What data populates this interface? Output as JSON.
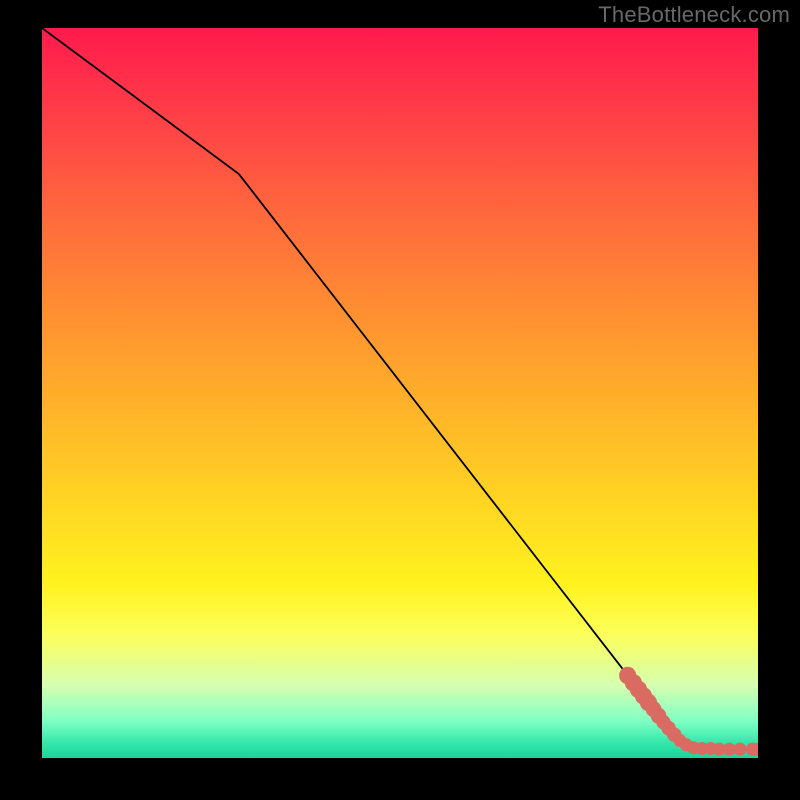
{
  "watermark": "TheBottleneck.com",
  "chart_data": {
    "type": "line",
    "title": "",
    "xlabel": "",
    "ylabel": "",
    "xlim": [
      0,
      100
    ],
    "ylim": [
      0,
      100
    ],
    "grid": false,
    "line_points": [
      {
        "x": 0,
        "y": 100
      },
      {
        "x": 27.5,
        "y": 80
      },
      {
        "x": 86,
        "y": 6
      },
      {
        "x": 91,
        "y": 1.4
      },
      {
        "x": 100,
        "y": 1.2
      }
    ],
    "markers": [
      {
        "x": 81.8,
        "y": 11.3,
        "r": 1.2
      },
      {
        "x": 82.6,
        "y": 10.3,
        "r": 1.2
      },
      {
        "x": 83.3,
        "y": 9.4,
        "r": 1.2
      },
      {
        "x": 84.0,
        "y": 8.5,
        "r": 1.2
      },
      {
        "x": 84.7,
        "y": 7.6,
        "r": 1.2
      },
      {
        "x": 85.4,
        "y": 6.7,
        "r": 1.1
      },
      {
        "x": 86.1,
        "y": 5.8,
        "r": 1.1
      },
      {
        "x": 86.8,
        "y": 4.9,
        "r": 1.0
      },
      {
        "x": 87.5,
        "y": 4.1,
        "r": 1.0
      },
      {
        "x": 88.3,
        "y": 3.2,
        "r": 1.0
      },
      {
        "x": 89.1,
        "y": 2.4,
        "r": 0.9
      },
      {
        "x": 90.0,
        "y": 1.8,
        "r": 0.9
      },
      {
        "x": 91.0,
        "y": 1.4,
        "r": 0.9
      },
      {
        "x": 92.2,
        "y": 1.3,
        "r": 0.9
      },
      {
        "x": 93.4,
        "y": 1.3,
        "r": 0.9
      },
      {
        "x": 94.6,
        "y": 1.2,
        "r": 0.9
      },
      {
        "x": 96.0,
        "y": 1.2,
        "r": 0.9
      },
      {
        "x": 97.5,
        "y": 1.2,
        "r": 0.9
      },
      {
        "x": 99.2,
        "y": 1.2,
        "r": 0.9
      },
      {
        "x": 100.0,
        "y": 1.2,
        "r": 0.9
      }
    ],
    "marker_color": "#d96b62",
    "line_color": "#000000"
  }
}
